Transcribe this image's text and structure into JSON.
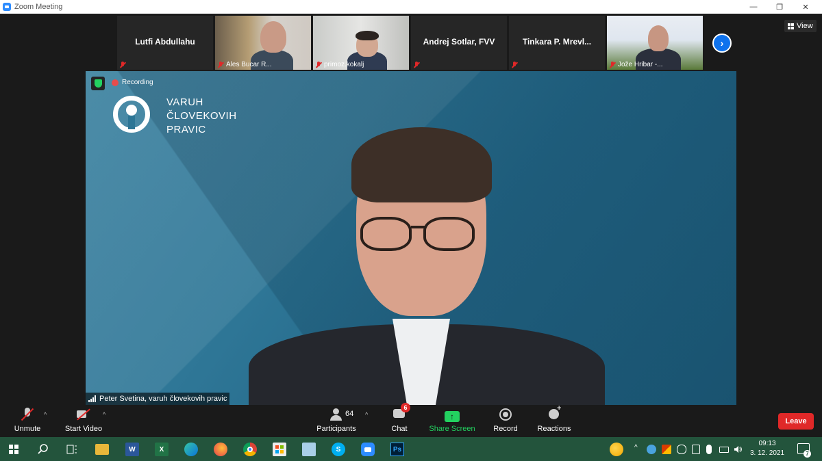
{
  "window": {
    "title": "Zoom Meeting",
    "minimize_glyph": "—",
    "maximize_glyph": "❐",
    "close_glyph": "✕"
  },
  "thumbnails": [
    {
      "name": "Lutfi Abdullahu",
      "video": false,
      "muted": true
    },
    {
      "name": "Ales Bucar R...",
      "video": true,
      "muted": true
    },
    {
      "name": "primoz.kokalj",
      "video": true,
      "muted": true
    },
    {
      "name": "Andrej Sotlar, FVV",
      "video": false,
      "muted": true
    },
    {
      "name": "Tinkara P. Mrevl...",
      "video": false,
      "muted": true
    },
    {
      "name": "Jože Hribar -...",
      "video": true,
      "muted": true
    }
  ],
  "nav": {
    "next_glyph": "›"
  },
  "view_button": {
    "label": "View"
  },
  "stage": {
    "recording_label": "Recording",
    "org_line1": "VARUH",
    "org_line2": "ČLOVEKOVIH",
    "org_line3": "PRAVIC",
    "speaker_name": "Peter Svetina, varuh človekovih pravic"
  },
  "toolbar": {
    "unmute": "Unmute",
    "start_video": "Start Video",
    "participants": "Participants",
    "participants_count": "64",
    "chat": "Chat",
    "chat_badge": "6",
    "share_screen": "Share Screen",
    "share_glyph": "↑",
    "record": "Record",
    "reactions": "Reactions",
    "leave": "Leave",
    "caret": "^"
  },
  "taskbar": {
    "icons": [
      "windows-icon",
      "search-icon",
      "task-view-icon",
      "file-explorer-icon",
      "word-icon",
      "excel-icon",
      "edge-icon",
      "firefox-icon",
      "chrome-icon",
      "store-icon",
      "remote-desktop-icon",
      "skype-icon",
      "zoom-icon",
      "photoshop-icon"
    ],
    "word_letter": "W",
    "excel_letter": "X",
    "skype_letter": "S",
    "ps_letter": "Ps",
    "time": "09:13",
    "date": "3. 12. 2021",
    "notifications_count": "7",
    "tray_chevron": "^"
  },
  "colors": {
    "accent_blue": "#2d8cff",
    "share_green": "#23d160",
    "leave_red": "#e02828",
    "taskbar_green": "#23543c",
    "stage_blue": "#2f7797"
  }
}
